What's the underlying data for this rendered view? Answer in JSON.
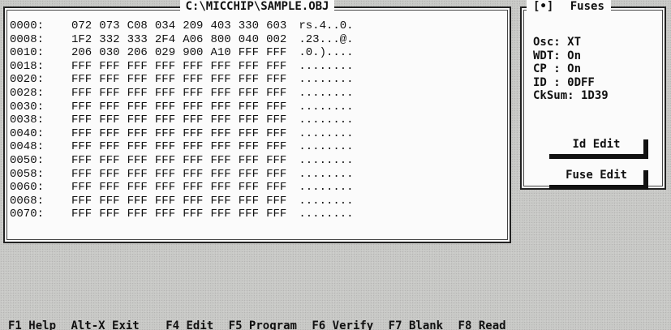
{
  "hex_window": {
    "title": "C:\\MICCHIP\\SAMPLE.OBJ",
    "rows": [
      {
        "addr": "0000:",
        "cells": [
          "072",
          "073",
          "C08",
          "034",
          "209",
          "403",
          "330",
          "603"
        ],
        "ascii": "rs.4..0."
      },
      {
        "addr": "0008:",
        "cells": [
          "1F2",
          "332",
          "333",
          "2F4",
          "A06",
          "800",
          "040",
          "002"
        ],
        "ascii": ".23...@."
      },
      {
        "addr": "0010:",
        "cells": [
          "206",
          "030",
          "206",
          "029",
          "900",
          "A10",
          "FFF",
          "FFF"
        ],
        "ascii": ".0.)...."
      },
      {
        "addr": "0018:",
        "cells": [
          "FFF",
          "FFF",
          "FFF",
          "FFF",
          "FFF",
          "FFF",
          "FFF",
          "FFF"
        ],
        "ascii": "........"
      },
      {
        "addr": "0020:",
        "cells": [
          "FFF",
          "FFF",
          "FFF",
          "FFF",
          "FFF",
          "FFF",
          "FFF",
          "FFF"
        ],
        "ascii": "........"
      },
      {
        "addr": "0028:",
        "cells": [
          "FFF",
          "FFF",
          "FFF",
          "FFF",
          "FFF",
          "FFF",
          "FFF",
          "FFF"
        ],
        "ascii": "........"
      },
      {
        "addr": "0030:",
        "cells": [
          "FFF",
          "FFF",
          "FFF",
          "FFF",
          "FFF",
          "FFF",
          "FFF",
          "FFF"
        ],
        "ascii": "........"
      },
      {
        "addr": "0038:",
        "cells": [
          "FFF",
          "FFF",
          "FFF",
          "FFF",
          "FFF",
          "FFF",
          "FFF",
          "FFF"
        ],
        "ascii": "........"
      },
      {
        "addr": "0040:",
        "cells": [
          "FFF",
          "FFF",
          "FFF",
          "FFF",
          "FFF",
          "FFF",
          "FFF",
          "FFF"
        ],
        "ascii": "........"
      },
      {
        "addr": "0048:",
        "cells": [
          "FFF",
          "FFF",
          "FFF",
          "FFF",
          "FFF",
          "FFF",
          "FFF",
          "FFF"
        ],
        "ascii": "........"
      },
      {
        "addr": "0050:",
        "cells": [
          "FFF",
          "FFF",
          "FFF",
          "FFF",
          "FFF",
          "FFF",
          "FFF",
          "FFF"
        ],
        "ascii": "........"
      },
      {
        "addr": "0058:",
        "cells": [
          "FFF",
          "FFF",
          "FFF",
          "FFF",
          "FFF",
          "FFF",
          "FFF",
          "FFF"
        ],
        "ascii": "........"
      },
      {
        "addr": "0060:",
        "cells": [
          "FFF",
          "FFF",
          "FFF",
          "FFF",
          "FFF",
          "FFF",
          "FFF",
          "FFF"
        ],
        "ascii": "........"
      },
      {
        "addr": "0068:",
        "cells": [
          "FFF",
          "FFF",
          "FFF",
          "FFF",
          "FFF",
          "FFF",
          "FFF",
          "FFF"
        ],
        "ascii": "........"
      },
      {
        "addr": "0070:",
        "cells": [
          "FFF",
          "FFF",
          "FFF",
          "FFF",
          "FFF",
          "FFF",
          "FFF",
          "FFF"
        ],
        "ascii": "........"
      }
    ]
  },
  "fuses_window": {
    "close_box": "[•]",
    "title": "Fuses",
    "lines": [
      "Osc: XT",
      "WDT: On",
      "CP : On",
      "ID : 0DFF",
      "CkSum: 1D39"
    ],
    "id_edit_label": "Id Edit",
    "fuse_edit_label": "Fuse Edit"
  },
  "function_keys": [
    "F1 Help",
    "Alt-X Exit",
    "F4 Edit",
    "F5 Program",
    "F6 Verify",
    "F7 Blank",
    "F8 Read"
  ]
}
